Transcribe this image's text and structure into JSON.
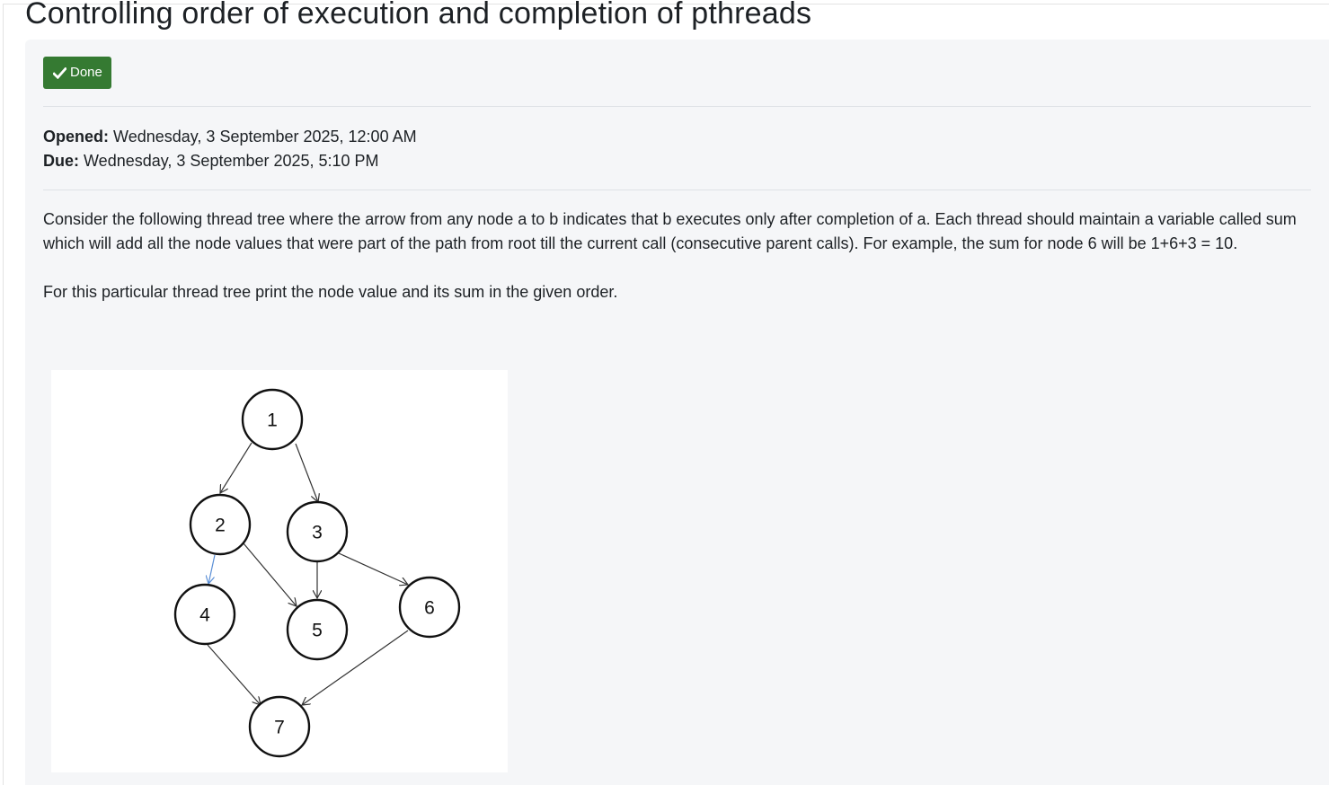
{
  "page": {
    "title": "Controlling order of execution and completion of pthreads"
  },
  "completion": {
    "done_label": "Done",
    "icon": "check-icon",
    "color": "#357a32"
  },
  "dates": {
    "opened_label": "Opened:",
    "opened_value": "Wednesday, 3 September 2025, 12:00 AM",
    "due_label": "Due:",
    "due_value": "Wednesday, 3 September 2025, 5:10 PM"
  },
  "description": {
    "paragraph1": "Consider the following thread tree where the arrow from any node a to b indicates that b executes only after completion of a. Each thread should maintain a variable called sum which will add all the node values that were part of the path from root till the current call (consecutive parent calls). For example, the sum for node 6 will be 1+6+3 = 10.",
    "paragraph2": "For this particular thread tree print the node value and its sum in the given order."
  },
  "thread_tree": {
    "nodes": [
      "1",
      "2",
      "3",
      "4",
      "5",
      "6",
      "7"
    ],
    "edges": [
      [
        "1",
        "2"
      ],
      [
        "1",
        "3"
      ],
      [
        "2",
        "4"
      ],
      [
        "2",
        "5"
      ],
      [
        "3",
        "5"
      ],
      [
        "3",
        "6"
      ],
      [
        "4",
        "7"
      ],
      [
        "6",
        "7"
      ]
    ]
  }
}
